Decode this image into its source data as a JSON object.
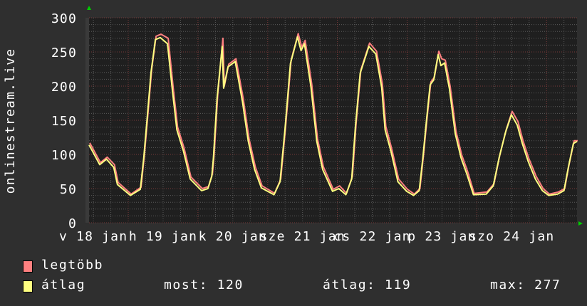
{
  "chart_data": {
    "type": "line",
    "ylabel": "onlinestream.live",
    "ylim": [
      0,
      300
    ],
    "yticks": [
      "0",
      "50",
      "100",
      "150",
      "200",
      "250",
      "300"
    ],
    "xlim": [
      "01-18 10:30",
      "01-25 10:30"
    ],
    "xticks": [
      {
        "at": "01-18 12:00",
        "label": "v 18 jan"
      },
      {
        "at": "01-19 12:00",
        "label": "h 19 jan"
      },
      {
        "at": "01-20 12:00",
        "label": "k 20 jan"
      },
      {
        "at": "01-21 12:00",
        "label": "sze 21 jan"
      },
      {
        "at": "01-22 12:00",
        "label": "cs 22 jan"
      },
      {
        "at": "01-23 12:00",
        "label": "p 23 jan"
      },
      {
        "at": "01-24 12:00",
        "label": "szo 24 jan"
      }
    ],
    "grid": true,
    "colors": {
      "background": "#2f2f2f",
      "plot": "#1f1f1f",
      "grid_minor": "#5a5a5a",
      "grid_major": "#7a3a3a",
      "arrow": "#00cc00"
    },
    "x": [
      "01-18 10:30",
      "01-18 14:10",
      "01-18 16:30",
      "01-18 19:00",
      "01-18 20:15",
      "01-19 00:45",
      "01-19 04:10",
      "01-19 05:20",
      "01-19 06:35",
      "01-19 07:50",
      "01-19 09:20",
      "01-19 11:00",
      "01-19 13:30",
      "01-19 15:15",
      "01-19 16:45",
      "01-19 19:00",
      "01-19 21:20",
      "01-20 01:15",
      "01-20 03:25",
      "01-20 04:45",
      "01-20 05:20",
      "01-20 06:35",
      "01-20 08:20",
      "01-20 08:50",
      "01-20 10:20",
      "01-20 12:50",
      "01-20 15:20",
      "01-20 17:20",
      "01-20 19:30",
      "01-20 21:50",
      "01-21 02:10",
      "01-21 04:15",
      "01-21 05:55",
      "01-21 07:50",
      "01-21 10:15",
      "01-21 11:30",
      "01-21 12:40",
      "01-21 14:55",
      "01-21 16:55",
      "01-21 18:55",
      "01-21 22:20",
      "01-22 00:30",
      "01-22 02:55",
      "01-22 04:55",
      "01-22 06:10",
      "01-22 07:50",
      "01-22 10:50",
      "01-22 13:15",
      "01-22 15:15",
      "01-22 16:25",
      "01-22 18:25",
      "01-22 20:50",
      "01-22 23:50",
      "01-23 02:15",
      "01-23 04:10",
      "01-23 05:25",
      "01-23 06:40",
      "01-23 07:55",
      "01-23 09:10",
      "01-23 10:40",
      "01-23 11:40",
      "01-23 12:55",
      "01-23 14:35",
      "01-23 16:35",
      "01-23 18:35",
      "01-23 20:35",
      "01-23 22:50",
      "01-24 03:15",
      "01-24 05:40",
      "01-24 07:40",
      "01-24 09:55",
      "01-24 11:55",
      "01-24 13:55",
      "01-24 15:40",
      "01-24 17:40",
      "01-24 20:10",
      "01-24 22:35",
      "01-25 00:45",
      "01-25 03:50",
      "01-25 06:00",
      "01-25 07:30",
      "01-25 09:15",
      "01-25 10:30"
    ],
    "series": [
      {
        "name": "legtöbb",
        "color": "#ff8080",
        "values": [
          117,
          88,
          96,
          85,
          59,
          42,
          52,
          100,
          162,
          225,
          273,
          276,
          270,
          197,
          140,
          109,
          67,
          50,
          53,
          72,
          100,
          188,
          270,
          200,
          232,
          240,
          182,
          123,
          82,
          54,
          43,
          64,
          140,
          238,
          277,
          257,
          267,
          203,
          123,
          82,
          49,
          54,
          43,
          68,
          144,
          224,
          263,
          251,
          203,
          141,
          109,
          64,
          49,
          42,
          50,
          100,
          155,
          206,
          213,
          251,
          240,
          238,
          200,
          134,
          99,
          75,
          43,
          45,
          57,
          99,
          137,
          163,
          148,
          120,
          94,
          68,
          50,
          42,
          45,
          50,
          85,
          120,
          120
        ]
      },
      {
        "name": "átlag",
        "color": "#ffff80",
        "values": [
          114,
          85,
          93,
          81,
          56,
          40,
          49,
          95,
          157,
          220,
          268,
          271,
          262,
          192,
          136,
          105,
          64,
          47,
          50,
          68,
          95,
          182,
          258,
          197,
          228,
          236,
          177,
          119,
          78,
          51,
          41,
          60,
          135,
          233,
          272,
          252,
          262,
          198,
          119,
          78,
          46,
          50,
          41,
          64,
          139,
          219,
          258,
          247,
          198,
          136,
          105,
          60,
          46,
          40,
          47,
          95,
          150,
          202,
          209,
          246,
          230,
          234,
          196,
          130,
          95,
          71,
          41,
          42,
          54,
          95,
          133,
          158,
          143,
          116,
          90,
          64,
          47,
          40,
          42,
          47,
          81,
          116,
          119
        ]
      }
    ]
  },
  "legend": {
    "items": [
      {
        "label": "legtöbb",
        "color": "#ff8080"
      },
      {
        "label": "átlag",
        "color": "#ffff80"
      }
    ],
    "stats": {
      "current": "most: 120",
      "average": "átlag: 119",
      "max": "max: 277"
    }
  }
}
